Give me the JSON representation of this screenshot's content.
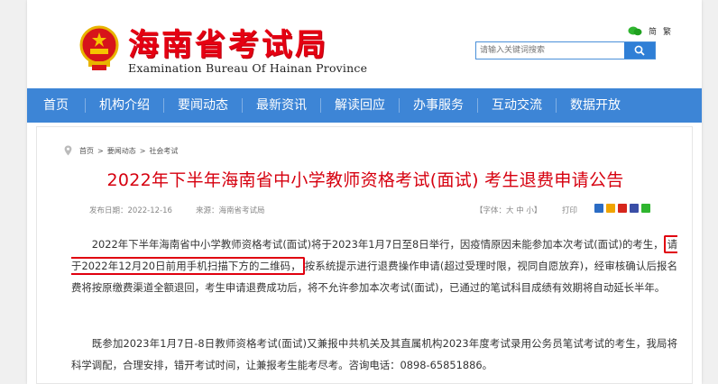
{
  "header": {
    "logo_cn": "海南省考试局",
    "logo_en": "Examination Bureau Of Hainan Province",
    "lang_simplified": "简",
    "lang_traditional": "繁",
    "search_placeholder": "请输入关键词搜索"
  },
  "nav": {
    "items": [
      {
        "label": "首页"
      },
      {
        "label": "机构介绍"
      },
      {
        "label": "要闻动态"
      },
      {
        "label": "最新资讯"
      },
      {
        "label": "解读回应"
      },
      {
        "label": "办事服务"
      },
      {
        "label": "互动交流"
      },
      {
        "label": "数据开放"
      }
    ]
  },
  "breadcrumb": {
    "items": [
      "首页",
      "要闻动态",
      "社会考试"
    ],
    "separator": ">"
  },
  "article": {
    "title": "2022年下半年海南省中小学教师资格考试(面试) 考生退费申请公告",
    "date": "发布日期：2022-12-16",
    "source": "来源：海南省考试局",
    "fontsize_label": "【字体：大 中 小】",
    "print_label": "打印",
    "para1_a": "2022年下半年海南省中小学教师资格考试(面试)将于2023年1月7日至8日举行，因疫情原因未能参加本次考试(面试)的考生，",
    "para1_highlight": "请于2022年12月20日前用手机扫描下方的二维码，",
    "para1_b": "按系统提示进行退费操作申请(超过受理时限，视同自愿放弃)，经审核确认后报名费将按原缴费渠道全额退回，考生申请退费成功后，将不允许参加本次考试(面试)，已通过的笔试科目成绩有效期将自动延长半年。",
    "para2": "既参加2023年1月7日-8日教师资格考试(面试)又兼报中共机关及其直属机构2023年度考试录用公务员笔试考试的考生，我局将科学调配，合理安排，错开考试时间，让兼报考生能考尽考。咨询电话：0898-65851886。"
  },
  "colors": {
    "brand_red": "#e60012",
    "nav_blue": "#3d85d6",
    "title_red": "#d6000f"
  }
}
